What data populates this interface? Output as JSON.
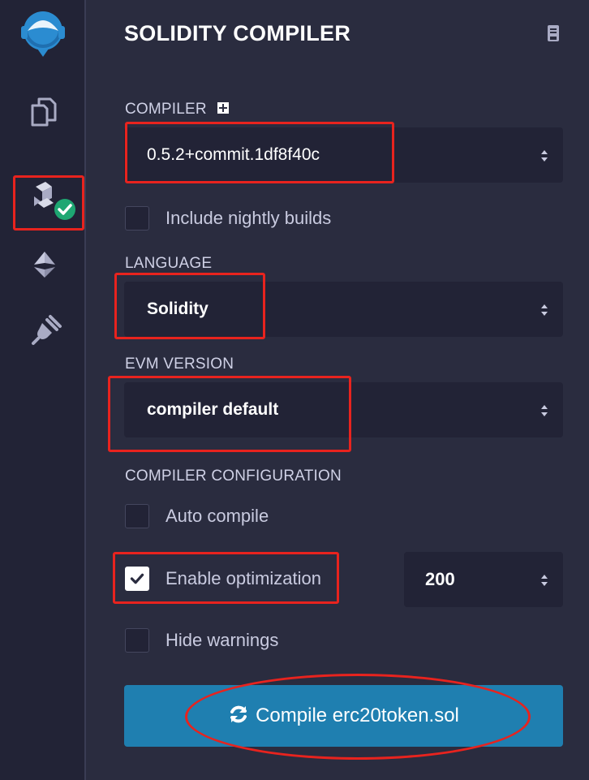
{
  "panel": {
    "title": "SOLIDITY COMPILER"
  },
  "compiler": {
    "label": "COMPILER",
    "version": "0.5.2+commit.1df8f40c",
    "nightly_label": "Include nightly builds",
    "nightly_checked": false
  },
  "language": {
    "label": "LANGUAGE",
    "value": "Solidity"
  },
  "evm": {
    "label": "EVM VERSION",
    "value": "compiler default"
  },
  "config": {
    "label": "COMPILER CONFIGURATION",
    "auto_compile_label": "Auto compile",
    "auto_compile_checked": false,
    "optimization_label": "Enable optimization",
    "optimization_checked": true,
    "runs": "200",
    "hide_warnings_label": "Hide warnings",
    "hide_warnings_checked": false
  },
  "compile_button": {
    "label": "Compile erc20token.sol"
  },
  "icons": {
    "logo": "remix-logo-icon",
    "files": "file-explorer-icon",
    "compiler": "solidity-compiler-icon",
    "deploy": "deploy-run-icon",
    "plugin": "plugin-manager-icon",
    "docs": "documentation-icon",
    "refresh": "refresh-icon"
  },
  "colors": {
    "panel_bg": "#2a2c3f",
    "input_bg": "#222336",
    "button": "#1f7fb0",
    "annotation": "#e8231e",
    "success": "#1ea772"
  }
}
